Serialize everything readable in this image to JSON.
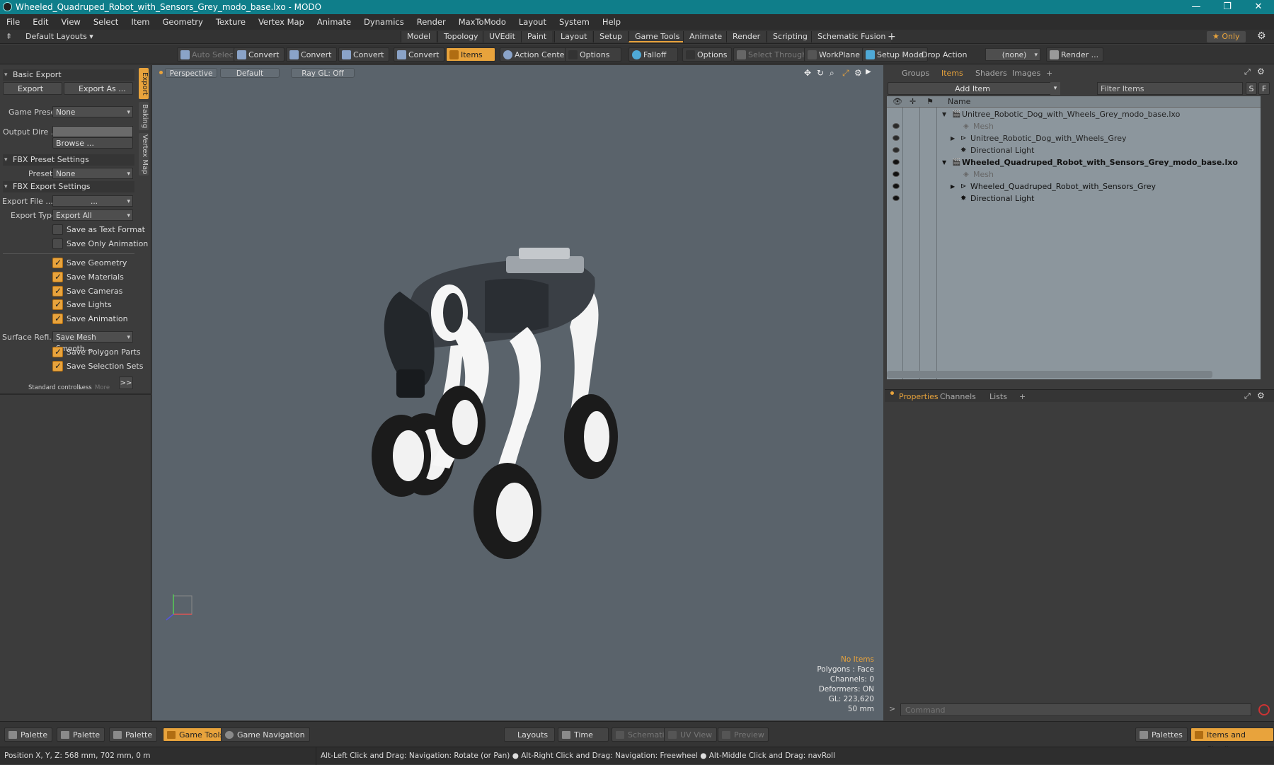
{
  "window": {
    "title": "Wheeled_Quadruped_Robot_with_Sensors_Grey_modo_base.lxo - MODO"
  },
  "menu": [
    "File",
    "Edit",
    "View",
    "Select",
    "Item",
    "Geometry",
    "Texture",
    "Vertex Map",
    "Animate",
    "Dynamics",
    "Render",
    "MaxToModo",
    "Layout",
    "System",
    "Help"
  ],
  "layouts": {
    "label": "Default Layouts ▾"
  },
  "workspace_tabs": [
    "Model",
    "Topology",
    "UVEdit",
    "Paint",
    "Layout",
    "Setup",
    "Game Tools",
    "Animate",
    "Render",
    "Scripting",
    "Schematic Fusion",
    "+"
  ],
  "only_label": "★  Only",
  "toolbar": {
    "auto_select": "Auto Select",
    "convert1": "Convert",
    "convert2": "Convert",
    "convert3": "Convert",
    "convert4": "Convert",
    "items": "Items",
    "action_center": "Action Center",
    "options1": "Options",
    "falloff": "Falloff",
    "options2": "Options",
    "select_through": "Select Through",
    "workplane": "WorkPlane",
    "setup_mode": "Setup Mode",
    "drop_action": "Drop Action",
    "drop_value": "(none)",
    "render": "Render ..."
  },
  "left": {
    "vtabs": [
      "Export",
      "Baking",
      "Vertex Map"
    ],
    "basic_export": "Basic Export",
    "export": "Export",
    "export_as": "Export As ...",
    "game_preset_label": "Game Preset",
    "game_preset_value": "None",
    "output_dir_label": "Output Dire ...",
    "browse": "Browse ...",
    "fbx_preset": "FBX Preset Settings",
    "preset_label": "Preset",
    "preset_value": "None",
    "fbx_export": "FBX Export Settings",
    "export_file_label": "Export File  ...",
    "export_file_value": "...",
    "export_type_label": "Export Type",
    "export_type_value": "Export All",
    "save_text": "Save as Text Format",
    "save_only_anim": "Save Only Animation",
    "save_geometry": "Save Geometry",
    "save_materials": "Save Materials",
    "save_cameras": "Save Cameras",
    "save_lights": "Save Lights",
    "save_animation": "Save Animation",
    "surface_label": "Surface Refi...",
    "surface_value": "Save Mesh Smooth...",
    "save_polygon_parts": "Save Polygon Parts",
    "save_selection_sets": "Save Selection Sets",
    "standard_controls": "Standard controls",
    "less": "Less",
    "more": "More",
    "expand": ">>"
  },
  "viewport": {
    "view": "Perspective",
    "shading": "Default",
    "raygl": "Ray GL: Off",
    "stats": [
      "No Items",
      "Polygons : Face",
      "Channels: 0",
      "Deformers: ON",
      "GL: 223,620",
      "50 mm"
    ]
  },
  "right": {
    "tabs": [
      "Groups",
      "Items",
      "Shaders",
      "Images",
      "+"
    ],
    "add_item": "Add Item",
    "filter": "Filter Items",
    "s": "S",
    "f": "F",
    "col_name": "Name",
    "tree": [
      {
        "text": "Unitree_Robotic_Dog_with_Wheels_Grey_modo_base.lxo",
        "bold": false
      },
      {
        "text": "Mesh",
        "bold": false
      },
      {
        "text": "Unitree_Robotic_Dog_with_Wheels_Grey",
        "bold": false
      },
      {
        "text": "Directional Light",
        "bold": false
      },
      {
        "text": "Wheeled_Quadruped_Robot_with_Sensors_Grey_modo_base.lxo",
        "bold": true
      },
      {
        "text": "Mesh",
        "bold": false
      },
      {
        "text": "Wheeled_Quadruped_Robot_with_Sensors_Grey",
        "bold": false
      },
      {
        "text": "Directional Light",
        "bold": false
      }
    ],
    "prop_tabs": [
      "Properties",
      "Channels",
      "Lists",
      "+"
    ],
    "command_placeholder": "Command"
  },
  "bottom": {
    "palette1": "Palette",
    "palette2": "Palette",
    "palette3": "Palette",
    "game_tools": "Game Tools",
    "game_nav": "Game Navigation",
    "layouts": "Layouts",
    "time": "Time",
    "schematic": "Schematic",
    "uv_view": "UV View",
    "preview": "Preview",
    "palettes": "Palettes",
    "items_shading": "Items and Shading"
  },
  "status": {
    "position": "Position X, Y, Z:   568 mm, 702 mm, 0 m",
    "hint": "Alt-Left Click and Drag: Navigation: Rotate (or Pan) ● Alt-Right Click and Drag: Navigation: Freewheel ● Alt-Middle Click and Drag: navRoll"
  },
  "colors": {
    "accent": "#e8a33c",
    "titlebar": "#0f7e8a",
    "viewport": "#5a636b"
  }
}
